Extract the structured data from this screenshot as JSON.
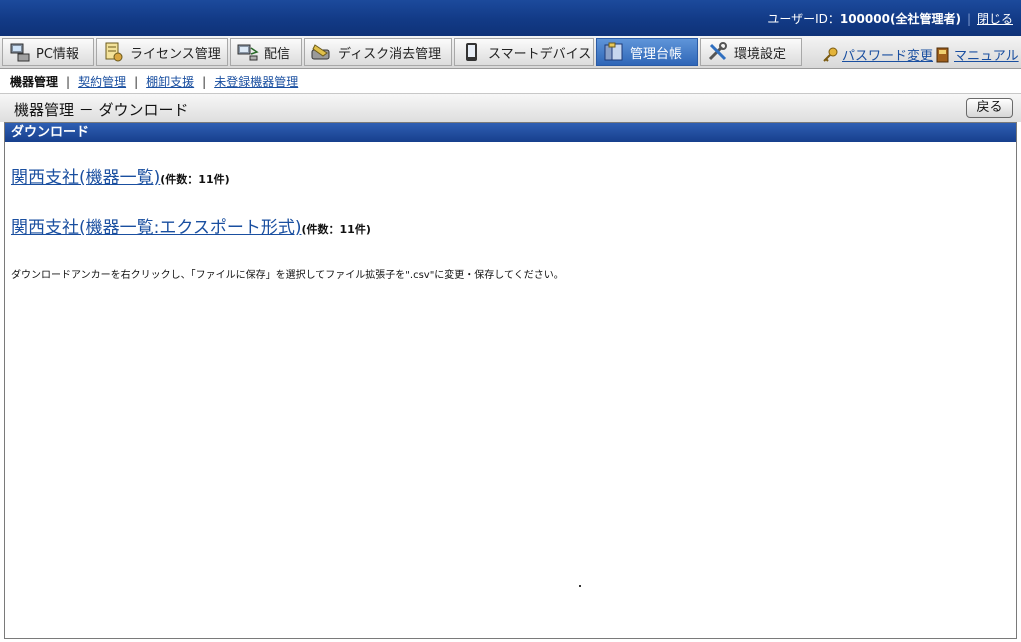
{
  "header": {
    "user_label": "ユーザーID：",
    "user_value": "100000(全社管理者)",
    "logout_label": "閉じる"
  },
  "menu": {
    "items": [
      {
        "label": "PC情報",
        "icon": "pc-icon"
      },
      {
        "label": "ライセンス管理",
        "icon": "license-icon"
      },
      {
        "label": "配信",
        "icon": "distribution-icon"
      },
      {
        "label": "ディスク消去管理",
        "icon": "disk-erase-icon"
      },
      {
        "label": "スマートデバイス",
        "icon": "smartphone-icon"
      },
      {
        "label": "管理台帳",
        "icon": "ledger-icon",
        "active": true
      },
      {
        "label": "環境設定",
        "icon": "settings-tools-icon"
      }
    ],
    "password_change_label": "パスワード変更",
    "manual_label": "マニュアル"
  },
  "subnav": {
    "current": "機器管理",
    "links": [
      "契約管理",
      "棚卸支援",
      "未登録機器管理"
    ],
    "separator": "|"
  },
  "page": {
    "title": "機器管理 － ダウンロード",
    "back_label": "戻る"
  },
  "panel": {
    "header": "ダウンロード",
    "downloads": [
      {
        "label": "関西支社(機器一覧)",
        "count": "(件数：11件)"
      },
      {
        "label": "関西支社(機器一覧:エクスポート形式)",
        "count": "(件数：11件)"
      }
    ],
    "note": "ダウンロードアンカーを右クリックし、「ファイルに保存」を選択してファイル拡張子を\".csv\"に変更・保存してください。"
  },
  "colors": {
    "header_bg": "#123a86",
    "active_tab": "#3a70c0",
    "link": "#1a4fa0"
  }
}
